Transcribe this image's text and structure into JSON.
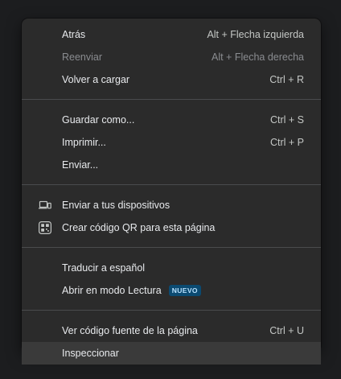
{
  "menu": {
    "groups": [
      [
        {
          "label": "Atrás",
          "shortcut": "Alt + Flecha izquierda"
        },
        {
          "label": "Reenviar",
          "shortcut": "Alt + Flecha derecha"
        },
        {
          "label": "Volver a cargar",
          "shortcut": "Ctrl + R"
        }
      ],
      [
        {
          "label": "Guardar como...",
          "shortcut": "Ctrl + S"
        },
        {
          "label": "Imprimir...",
          "shortcut": "Ctrl + P"
        },
        {
          "label": "Enviar..."
        }
      ],
      [
        {
          "label": "Enviar a tus dispositivos",
          "icon": "laptop-phone-icon"
        },
        {
          "label": "Crear código QR para esta página",
          "icon": "qr-code-icon"
        }
      ],
      [
        {
          "label": "Traducir a español"
        },
        {
          "label": "Abrir en modo Lectura",
          "badge": "NUEVO"
        }
      ],
      [
        {
          "label": "Ver código fuente de la página",
          "shortcut": "Ctrl + U"
        },
        {
          "label": "Inspeccionar"
        }
      ]
    ]
  },
  "colors": {
    "menu_background": "#2b2b2b",
    "text": "#e8eaed",
    "disabled_text": "#8a8c90",
    "highlight": "#3a3a3a",
    "badge_background": "#0b4a71",
    "badge_text": "#b9e2ff"
  }
}
